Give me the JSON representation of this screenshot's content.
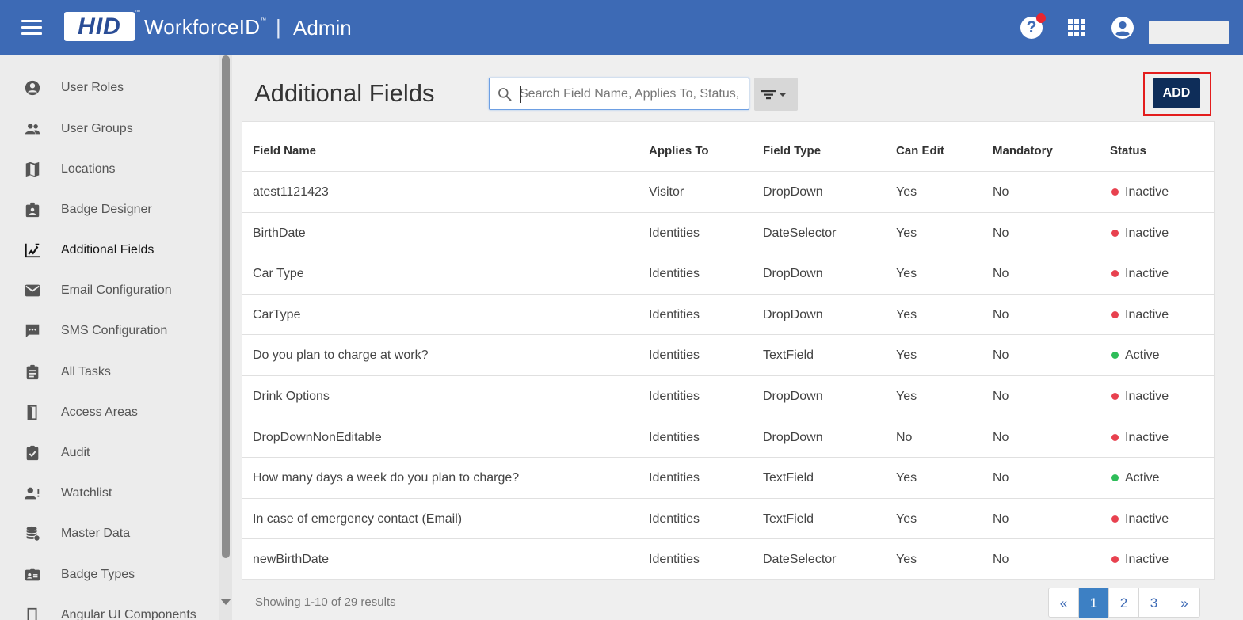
{
  "header": {
    "logo_text": "HID",
    "product_name": "WorkforceID",
    "product_tm": "™",
    "separator": "|",
    "section": "Admin",
    "help_icon_glyph": "?",
    "icons": [
      "menu-icon",
      "help-icon",
      "apps-grid-icon",
      "account-circle-icon"
    ]
  },
  "sidebar": {
    "items": [
      {
        "label": "User Roles",
        "icon": "user-roles-icon"
      },
      {
        "label": "User Groups",
        "icon": "user-groups-icon"
      },
      {
        "label": "Locations",
        "icon": "map-icon"
      },
      {
        "label": "Badge Designer",
        "icon": "badge-designer-icon"
      },
      {
        "label": "Additional Fields",
        "icon": "additional-fields-icon",
        "active": true
      },
      {
        "label": "Email Configuration",
        "icon": "email-icon"
      },
      {
        "label": "SMS Configuration",
        "icon": "sms-icon"
      },
      {
        "label": "All Tasks",
        "icon": "tasks-clipboard-icon"
      },
      {
        "label": "Access Areas",
        "icon": "door-icon"
      },
      {
        "label": "Audit",
        "icon": "audit-check-icon"
      },
      {
        "label": "Watchlist",
        "icon": "watchlist-icon"
      },
      {
        "label": "Master Data",
        "icon": "database-icon"
      },
      {
        "label": "Badge Types",
        "icon": "badge-card-icon"
      },
      {
        "label": "Angular UI Components",
        "icon": "component-icon"
      }
    ]
  },
  "main": {
    "title": "Additional Fields",
    "search": {
      "placeholder": "Search Field Name, Applies To, Status, Fi",
      "value": ""
    },
    "add_label": "ADD",
    "table": {
      "columns": [
        "Field Name",
        "Applies To",
        "Field Type",
        "Can Edit",
        "Mandatory",
        "Status"
      ],
      "rows": [
        {
          "field_name": "atest1121423",
          "applies_to": "Visitor",
          "field_type": "DropDown",
          "can_edit": "Yes",
          "mandatory": "No",
          "status": "Inactive"
        },
        {
          "field_name": "BirthDate",
          "applies_to": "Identities",
          "field_type": "DateSelector",
          "can_edit": "Yes",
          "mandatory": "No",
          "status": "Inactive"
        },
        {
          "field_name": "Car Type",
          "applies_to": "Identities",
          "field_type": "DropDown",
          "can_edit": "Yes",
          "mandatory": "No",
          "status": "Inactive"
        },
        {
          "field_name": "CarType",
          "applies_to": "Identities",
          "field_type": "DropDown",
          "can_edit": "Yes",
          "mandatory": "No",
          "status": "Inactive"
        },
        {
          "field_name": "Do you plan to charge at work?",
          "applies_to": "Identities",
          "field_type": "TextField",
          "can_edit": "Yes",
          "mandatory": "No",
          "status": "Active"
        },
        {
          "field_name": "Drink Options",
          "applies_to": "Identities",
          "field_type": "DropDown",
          "can_edit": "Yes",
          "mandatory": "No",
          "status": "Inactive"
        },
        {
          "field_name": "DropDownNonEditable",
          "applies_to": "Identities",
          "field_type": "DropDown",
          "can_edit": "No",
          "mandatory": "No",
          "status": "Inactive"
        },
        {
          "field_name": "How many days a week do you plan to charge?",
          "applies_to": "Identities",
          "field_type": "TextField",
          "can_edit": "Yes",
          "mandatory": "No",
          "status": "Active"
        },
        {
          "field_name": "In case of emergency contact (Email)",
          "applies_to": "Identities",
          "field_type": "TextField",
          "can_edit": "Yes",
          "mandatory": "No",
          "status": "Inactive"
        },
        {
          "field_name": "newBirthDate",
          "applies_to": "Identities",
          "field_type": "DateSelector",
          "can_edit": "Yes",
          "mandatory": "No",
          "status": "Inactive"
        }
      ]
    },
    "footer_text": "Showing 1-10 of 29 results",
    "pagination": {
      "first": "«",
      "pages": [
        "1",
        "2",
        "3"
      ],
      "current": "1",
      "last": "»"
    }
  },
  "colors": {
    "header_bg": "#3d6ab5",
    "add_button": "#0e2d59",
    "highlight_border": "#e31d1d",
    "status_active": "#2ebd59",
    "status_inactive": "#e8414f",
    "pagination_current": "#3d80c4"
  }
}
